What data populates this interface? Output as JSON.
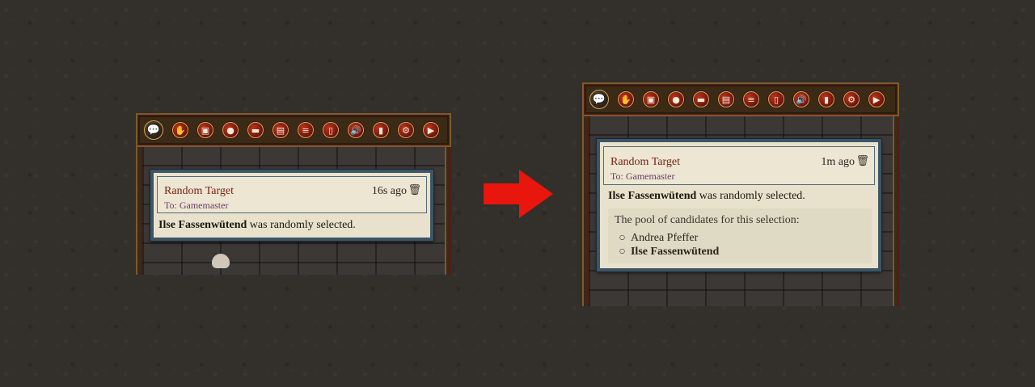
{
  "toolbar": {
    "icons": [
      "chat-icon",
      "hand-icon",
      "image-icon",
      "person-icon",
      "briefcase-icon",
      "cards-icon",
      "list-icon",
      "portrait-icon",
      "speaker-icon",
      "book-icon",
      "gear-icon",
      "play-icon"
    ],
    "glyphs": [
      "💬",
      "✋",
      "▣",
      "●",
      "▬",
      "▤",
      "≡",
      "▯",
      "🔊",
      "▮",
      "⚙",
      "▶"
    ]
  },
  "before": {
    "title": "Random Target",
    "to": "To: Gamemaster",
    "time": "16s ago",
    "name": "Ilse Fassenwütend",
    "message_rest": " was randomly selected."
  },
  "after": {
    "title": "Random Target",
    "to": "To: Gamemaster",
    "time": "1m ago",
    "name": "Ilse Fassenwütend",
    "message_rest": " was randomly selected.",
    "pool_title": "The pool of candidates for this selection:",
    "candidates": [
      "Andrea Pfeffer",
      "Ilse Fassenwütend"
    ]
  },
  "colors": {
    "arrow": "#e8160c",
    "title": "#7a1e14",
    "card_border": "#3d5566"
  }
}
